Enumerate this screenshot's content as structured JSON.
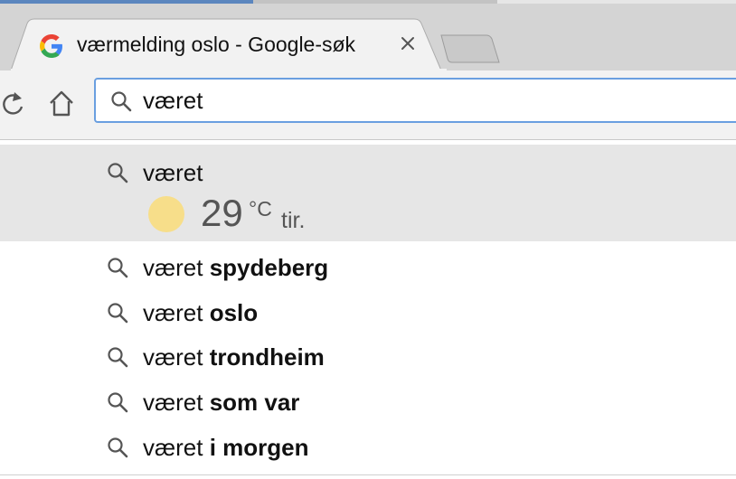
{
  "browser": {
    "tab": {
      "title": "værmelding oslo - Google-søk",
      "favicon": "google-g-icon",
      "close_icon": "close-icon"
    },
    "new_tab_icon": "new-tab-icon",
    "toolbar": {
      "reload_icon": "reload-icon",
      "home_icon": "home-icon"
    },
    "omnibox": {
      "icon": "search-icon",
      "value": "været"
    }
  },
  "suggestions": {
    "weather": {
      "prefix": "været",
      "icon": "sun-icon",
      "temperature": "29",
      "unit": "°C",
      "day": "tir."
    },
    "items": [
      {
        "typed": "været ",
        "completion": "spydeberg"
      },
      {
        "typed": "været ",
        "completion": "oslo"
      },
      {
        "typed": "været ",
        "completion": "trondheim"
      },
      {
        "typed": "været ",
        "completion": "som var"
      },
      {
        "typed": "været ",
        "completion": "i morgen"
      }
    ]
  },
  "colors": {
    "tabstrip": "#d4d4d4",
    "omnibox_focus": "#6a9fe0",
    "highlight_row": "#e6e6e6",
    "sun": "#f7de8a"
  }
}
